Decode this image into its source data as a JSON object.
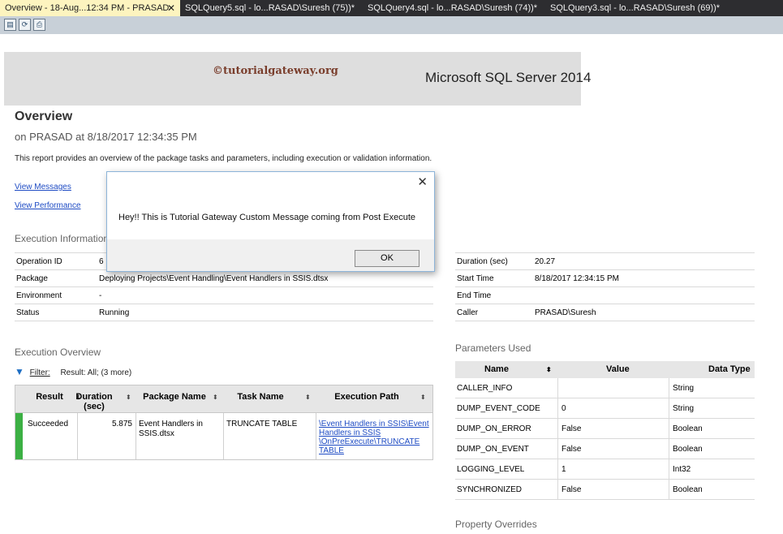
{
  "tabs": [
    {
      "label": "Overview - 18-Aug...12:34 PM - PRASAD",
      "close": "✕"
    },
    {
      "label": "SQLQuery5.sql - lo...RASAD\\Suresh (75))*"
    },
    {
      "label": "SQLQuery4.sql - lo...RASAD\\Suresh (74))*"
    },
    {
      "label": "SQLQuery3.sql - lo...RASAD\\Suresh (69))*"
    }
  ],
  "toolbar": {
    "icons": [
      "document-map-icon",
      "refresh-icon",
      "print-icon"
    ]
  },
  "banner": {
    "watermark": "©tutorialgateway.org",
    "product": "Microsoft SQL Server 2014"
  },
  "report": {
    "title": "Overview",
    "subtitle": "on PRASAD at 8/18/2017 12:34:35 PM",
    "description": "This report provides an overview of the package tasks and parameters, including execution or validation information.",
    "links": [
      "View Messages",
      "View Performance"
    ]
  },
  "execution_information": {
    "heading": "Execution Information",
    "left_rows": [
      {
        "label": "Operation ID",
        "value": "6"
      },
      {
        "label": "Package",
        "value": "Deploying Projects\\Event Handling\\Event Handlers in SSIS.dtsx"
      },
      {
        "label": "Environment",
        "value": "-"
      },
      {
        "label": "Status",
        "value": "Running"
      }
    ],
    "right_rows": [
      {
        "label": "Duration (sec)",
        "value": "20.27"
      },
      {
        "label": "Start Time",
        "value": "8/18/2017 12:34:15 PM"
      },
      {
        "label": "End Time",
        "value": ""
      },
      {
        "label": "Caller",
        "value": "PRASAD\\Suresh"
      }
    ]
  },
  "execution_overview": {
    "heading": "Execution Overview",
    "filter_label": "Filter:",
    "filter_text": "Result: All; (3 more)",
    "columns": [
      "Result",
      "Duration (sec)",
      "Package Name",
      "Task Name",
      "Execution Path"
    ],
    "sort_glyph": "⬍",
    "rows": [
      {
        "result": "Succeeded",
        "duration": "5.875",
        "package": "Event Handlers in SSIS.dtsx",
        "task": "TRUNCATE TABLE",
        "path": "\\Event Handlers in SSIS\\Event Handlers in SSIS \\OnPreExecute\\TRUNCATE TABLE"
      }
    ]
  },
  "parameters_used": {
    "heading": "Parameters Used",
    "columns": [
      "Name",
      "Value",
      "Data Type"
    ],
    "sort_glyph": "⬍",
    "rows": [
      {
        "name": "CALLER_INFO",
        "value": "",
        "type": "String"
      },
      {
        "name": "DUMP_EVENT_CODE",
        "value": "0",
        "type": "String"
      },
      {
        "name": "DUMP_ON_ERROR",
        "value": "False",
        "type": "Boolean"
      },
      {
        "name": "DUMP_ON_EVENT",
        "value": "False",
        "type": "Boolean"
      },
      {
        "name": "LOGGING_LEVEL",
        "value": "1",
        "type": "Int32"
      },
      {
        "name": "SYNCHRONIZED",
        "value": "False",
        "type": "Boolean"
      }
    ]
  },
  "property_overrides": {
    "heading": "Property Overrides"
  },
  "dialog": {
    "close_glyph": "✕",
    "message": "Hey!! This is Tutorial Gateway Custom Message coming from Post Execute",
    "ok_label": "OK"
  },
  "colors": {
    "active_tab": "#fdf4bf",
    "tab_strip": "#2d2d30",
    "link": "#1f4cc4",
    "success_bar": "#3cb044"
  }
}
